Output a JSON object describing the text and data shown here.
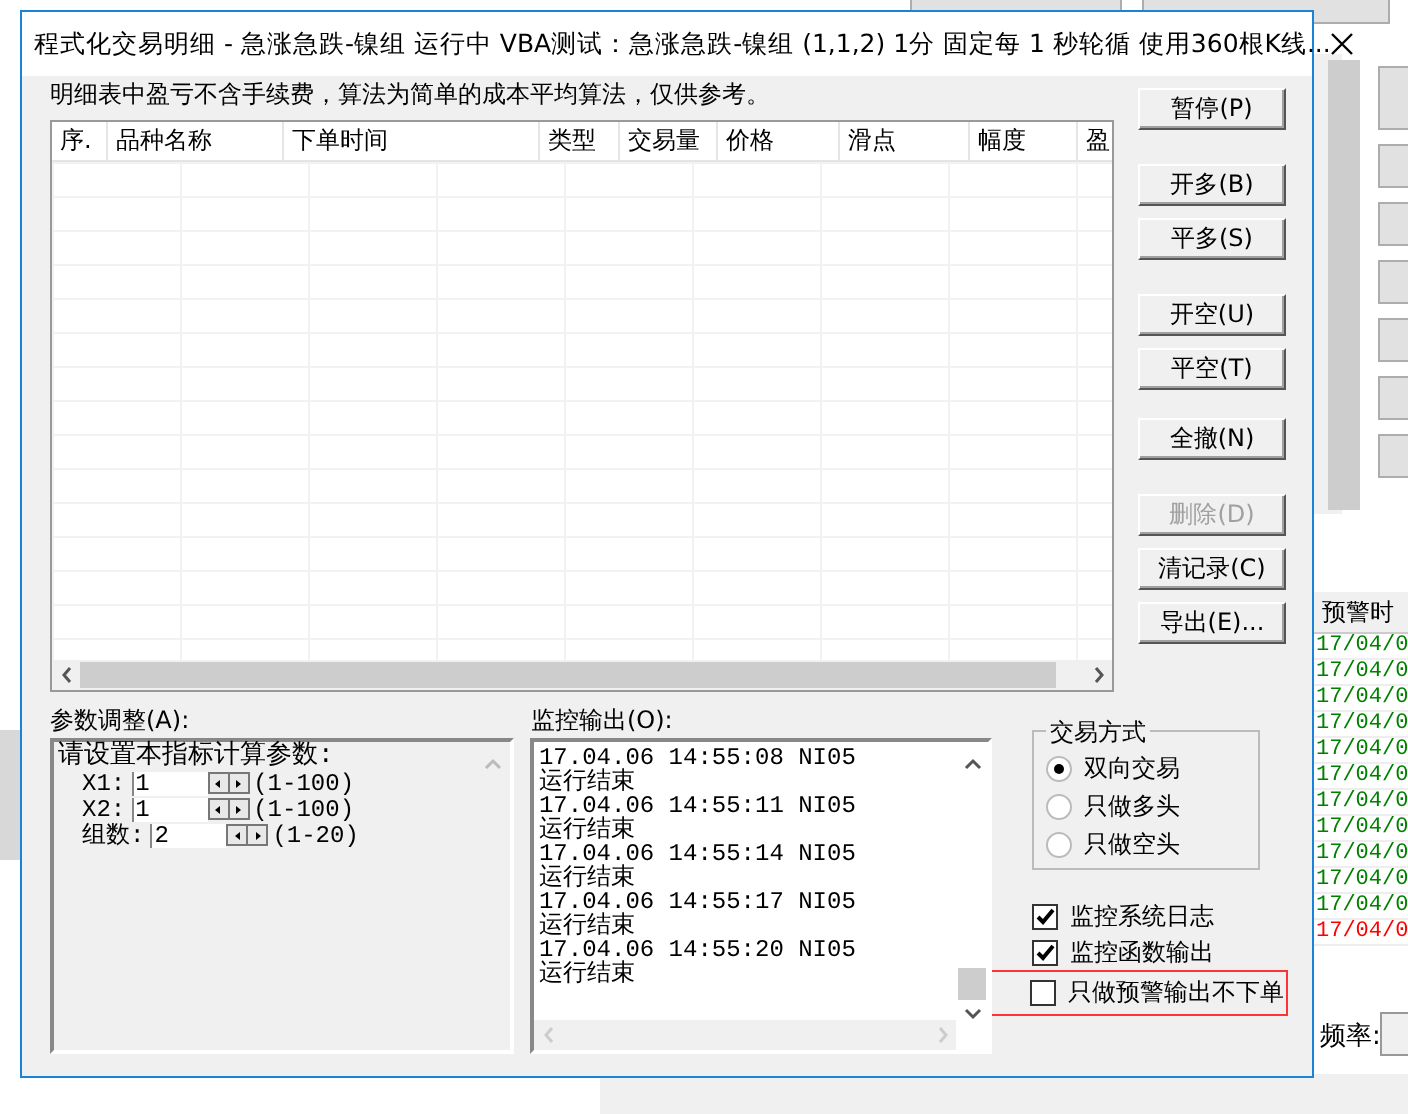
{
  "background_app": {
    "alert_table": {
      "column_1": "预警时",
      "rows": [
        {
          "text": "17/04/0",
          "color": "#008000"
        },
        {
          "text": "17/04/0",
          "color": "#008000"
        },
        {
          "text": "17/04/0",
          "color": "#008000"
        },
        {
          "text": "17/04/0",
          "color": "#008000"
        },
        {
          "text": "17/04/0",
          "color": "#008000"
        },
        {
          "text": "17/04/0",
          "color": "#008000"
        },
        {
          "text": "17/04/0",
          "color": "#008000"
        },
        {
          "text": "17/04/0",
          "color": "#008000"
        },
        {
          "text": "17/04/0",
          "color": "#008000"
        },
        {
          "text": "17/04/0",
          "color": "#008000"
        },
        {
          "text": "17/04/0",
          "color": "#008000"
        },
        {
          "text": "17/04/0",
          "color": "#ff0000"
        }
      ]
    },
    "frequency": {
      "label": "频率:"
    }
  },
  "window": {
    "title": "程式化交易明细 - 急涨急跌-镍组 运行中  VBA测试：急涨急跌-镍组 (1,1,2) 1分 固定每 1 秒轮循 使用360根K线..."
  },
  "note": "明细表中盈亏不含手续费，算法为简单的成本平均算法，仅供参考。",
  "table": {
    "columns": [
      "序.",
      "品种名称",
      "下单时间",
      "类型",
      "交易量",
      "价格",
      "滑点",
      "幅度",
      "盈"
    ]
  },
  "button_groups": [
    [
      {
        "label": "暂停(P)",
        "disabled": false
      }
    ],
    [
      {
        "label": "开多(B)",
        "disabled": false
      },
      {
        "label": "平多(S)",
        "disabled": false
      }
    ],
    [
      {
        "label": "开空(U)",
        "disabled": false
      },
      {
        "label": "平空(T)",
        "disabled": false
      }
    ],
    [
      {
        "label": "全撤(N)",
        "disabled": false
      }
    ],
    [
      {
        "label": "删除(D)",
        "disabled": true
      },
      {
        "label": "清记录(C)",
        "disabled": false
      },
      {
        "label": "导出(E)...",
        "disabled": false
      }
    ]
  ],
  "params": {
    "label": "参数调整(A):",
    "heading": "请设置本指标计算参数:",
    "rows": [
      {
        "name": "X1:",
        "value": "1",
        "range": "(1-100)"
      },
      {
        "name": "X2:",
        "value": "1",
        "range": "(1-100)"
      },
      {
        "name": "组数:",
        "value": "2",
        "range": "(1-20)"
      }
    ]
  },
  "monitor": {
    "label": "监控输出(O):",
    "lines": [
      "17.04.06 14:55:08 NI05",
      "运行结束",
      "17.04.06 14:55:11 NI05",
      "运行结束",
      "17.04.06 14:55:14 NI05",
      "运行结束",
      "17.04.06 14:55:17 NI05",
      "运行结束",
      "17.04.06 14:55:20 NI05",
      "运行结束"
    ]
  },
  "trade_mode": {
    "title": "交易方式",
    "options": [
      {
        "label": "双向交易",
        "selected": true
      },
      {
        "label": "只做多头",
        "selected": false
      },
      {
        "label": "只做空头",
        "selected": false
      }
    ]
  },
  "options": [
    {
      "label": "监控系统日志",
      "checked": true,
      "highlighted": false
    },
    {
      "label": "监控函数输出",
      "checked": true,
      "highlighted": false
    },
    {
      "label": "只做预警输出不下单",
      "checked": false,
      "highlighted": true
    }
  ]
}
